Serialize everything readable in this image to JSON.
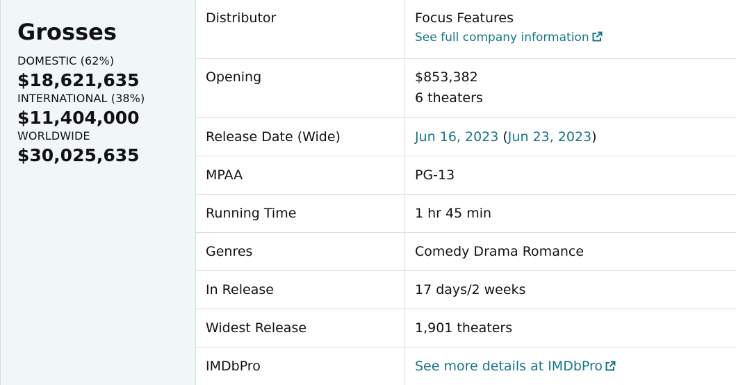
{
  "grosses": {
    "title": "Grosses",
    "domestic_label": "DOMESTIC (62%)",
    "domestic_value": "$18,621,635",
    "international_label": "INTERNATIONAL (38%)",
    "international_value": "$11,404,000",
    "worldwide_label": "WORLDWIDE",
    "worldwide_value": "$30,025,635"
  },
  "summary": {
    "distributor_label": "Distributor",
    "distributor_value": "Focus Features",
    "distributor_link": "See full company information",
    "opening_label": "Opening",
    "opening_value": "$853,382",
    "opening_theaters": "6 theaters",
    "release_label": "Release Date (Wide)",
    "release_date": "Jun 16, 2023",
    "release_open_paren": " (",
    "release_wide_date": "Jun 23, 2023",
    "release_close_paren": ")",
    "mpaa_label": "MPAA",
    "mpaa_value": "PG-13",
    "running_label": "Running Time",
    "running_value": "1 hr 45 min",
    "genres_label": "Genres",
    "genres_value": "Comedy Drama Romance",
    "inrelease_label": "In Release",
    "inrelease_value": "17 days/2 weeks",
    "widest_label": "Widest Release",
    "widest_value": "1,901 theaters",
    "imdbpro_label": "IMDbPro",
    "imdbpro_link": "See more details at IMDbPro"
  },
  "colors": {
    "link": "#157585",
    "panel_bg": "#f1f7f9",
    "border": "#d9dede"
  },
  "icons": {
    "external": "external-link-icon"
  }
}
